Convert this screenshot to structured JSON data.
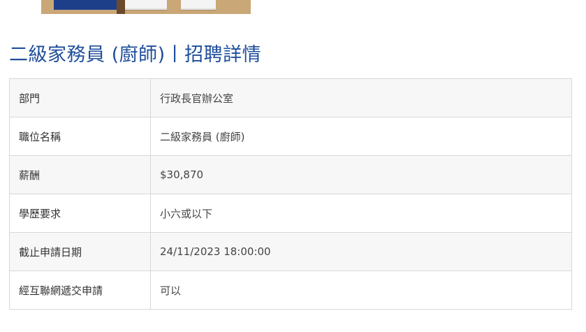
{
  "page": {
    "title": "二級家務員 (廚師)丨招聘詳情"
  },
  "details": {
    "rows": [
      {
        "label": "部門",
        "value": "行政長官辦公室"
      },
      {
        "label": "職位名稱",
        "value": "二級家務員 (廚師)"
      },
      {
        "label": "薪酬",
        "value": "$30,870"
      },
      {
        "label": "學歷要求",
        "value": "小六或以下"
      },
      {
        "label": "截止申請日期",
        "value": "24/11/2023 18:00:00"
      },
      {
        "label": "經互聯網遞交申請",
        "value": "可以"
      }
    ]
  },
  "colors": {
    "title": "#1f4e9c",
    "border": "#d8d8d8",
    "row_shade": "#f7f7f7"
  }
}
